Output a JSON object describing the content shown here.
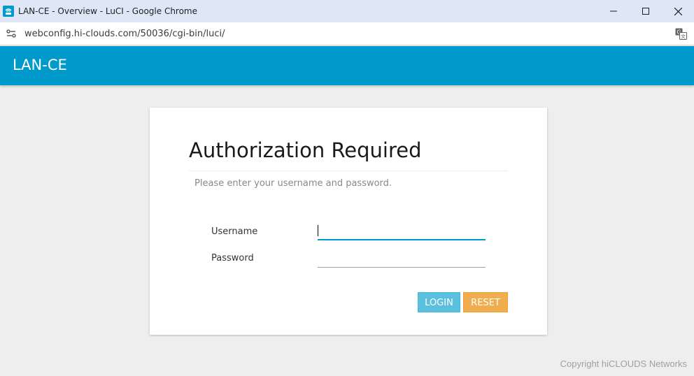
{
  "window": {
    "title": "LAN-CE - Overview - LuCI - Google Chrome",
    "favicon": "router-icon"
  },
  "addressbar": {
    "url": "webconfig.hi-clouds.com/50036/cgi-bin/luci/"
  },
  "header": {
    "brand": "LAN-CE",
    "color": "#0099cc"
  },
  "login": {
    "title": "Authorization Required",
    "hint": "Please enter your username and password.",
    "username_label": "Username",
    "password_label": "Password",
    "username_value": "",
    "password_value": "",
    "login_label": "LOGIN",
    "reset_label": "RESET",
    "login_color": "#5bc0de",
    "reset_color": "#f0ad4e"
  },
  "footer": {
    "copyright": "Copyright hiCLOUDS Networks"
  }
}
